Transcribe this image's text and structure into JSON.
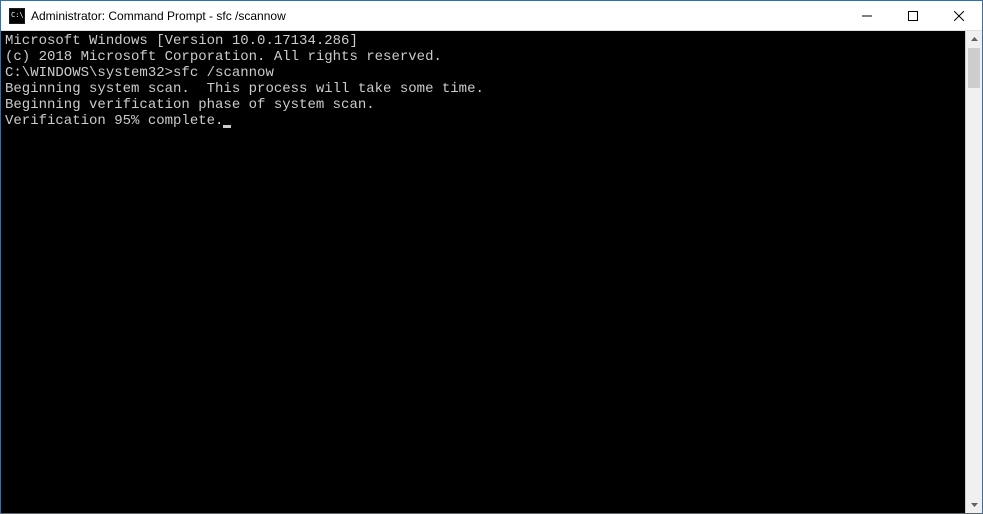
{
  "window": {
    "title": "Administrator: Command Prompt - sfc  /scannow"
  },
  "terminal": {
    "line1": "Microsoft Windows [Version 10.0.17134.286]",
    "line2": "(c) 2018 Microsoft Corporation. All rights reserved.",
    "blank1": "",
    "prompt": "C:\\WINDOWS\\system32>",
    "command": "sfc /scannow",
    "blank2": "",
    "line3": "Beginning system scan.  This process will take some time.",
    "blank3": "",
    "line4": "Beginning verification phase of system scan.",
    "line5": "Verification 95% complete."
  }
}
